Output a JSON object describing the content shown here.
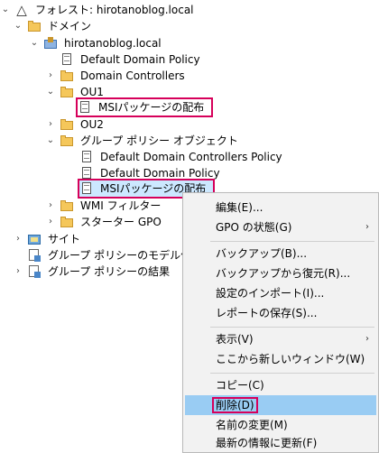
{
  "tree": [
    {
      "id": "forest",
      "label": "フォレスト: hirotanoblog.local",
      "expander": "⌄",
      "icon": "tri"
    },
    {
      "id": "domains",
      "label": "ドメイン",
      "expander": "⌄",
      "icon": "folder"
    },
    {
      "id": "domain",
      "label": "hirotanoblog.local",
      "expander": "⌄",
      "icon": "domain"
    },
    {
      "id": "ddp",
      "label": "Default Domain Policy",
      "expander": "",
      "icon": "doc"
    },
    {
      "id": "dc",
      "label": "Domain Controllers",
      "expander": "›",
      "icon": "folder"
    },
    {
      "id": "ou1",
      "label": "OU1",
      "expander": "⌄",
      "icon": "folder"
    },
    {
      "id": "ou1-msi",
      "label": "MSIパッケージの配布",
      "expander": "",
      "icon": "doc"
    },
    {
      "id": "ou2",
      "label": "OU2",
      "expander": "›",
      "icon": "folder"
    },
    {
      "id": "gpo",
      "label": "グループ ポリシー オブジェクト",
      "expander": "⌄",
      "icon": "folder"
    },
    {
      "id": "ddcp",
      "label": "Default Domain Controllers Policy",
      "expander": "",
      "icon": "doc"
    },
    {
      "id": "ddp2",
      "label": "Default Domain Policy",
      "expander": "",
      "icon": "doc"
    },
    {
      "id": "msi",
      "label": "MSIパッケージの配布",
      "expander": "",
      "icon": "doc"
    },
    {
      "id": "wmi",
      "label": "WMI フィルター",
      "expander": "›",
      "icon": "folder"
    },
    {
      "id": "starter",
      "label": "スターター GPO",
      "expander": "›",
      "icon": "folder"
    },
    {
      "id": "sites",
      "label": "サイト",
      "expander": "›",
      "icon": "site"
    },
    {
      "id": "model",
      "label": "グループ ポリシーのモデル作成",
      "expander": "",
      "icon": "report"
    },
    {
      "id": "results",
      "label": "グループ ポリシーの結果",
      "expander": "›",
      "icon": "report"
    }
  ],
  "context_menu": {
    "items": [
      {
        "label": "編集(E)...",
        "submenu": ""
      },
      {
        "label": "GPO の状態(G)",
        "submenu": "›"
      },
      {
        "label": "バックアップ(B)...",
        "submenu": ""
      },
      {
        "label": "バックアップから復元(R)...",
        "submenu": ""
      },
      {
        "label": "設定のインポート(I)...",
        "submenu": ""
      },
      {
        "label": "レポートの保存(S)...",
        "submenu": ""
      },
      {
        "label": "表示(V)",
        "submenu": "›"
      },
      {
        "label": "ここから新しいウィンドウ(W)",
        "submenu": ""
      },
      {
        "label": "コピー(C)",
        "submenu": ""
      },
      {
        "label": "削除(D)",
        "submenu": ""
      },
      {
        "label": "名前の変更(M)",
        "submenu": ""
      },
      {
        "label": "最新の情報に更新(F)",
        "submenu": ""
      }
    ]
  },
  "colors": {
    "selection": "#cce8ff",
    "menu_highlight": "#99ccf3",
    "annotation_box": "#d6005a"
  }
}
